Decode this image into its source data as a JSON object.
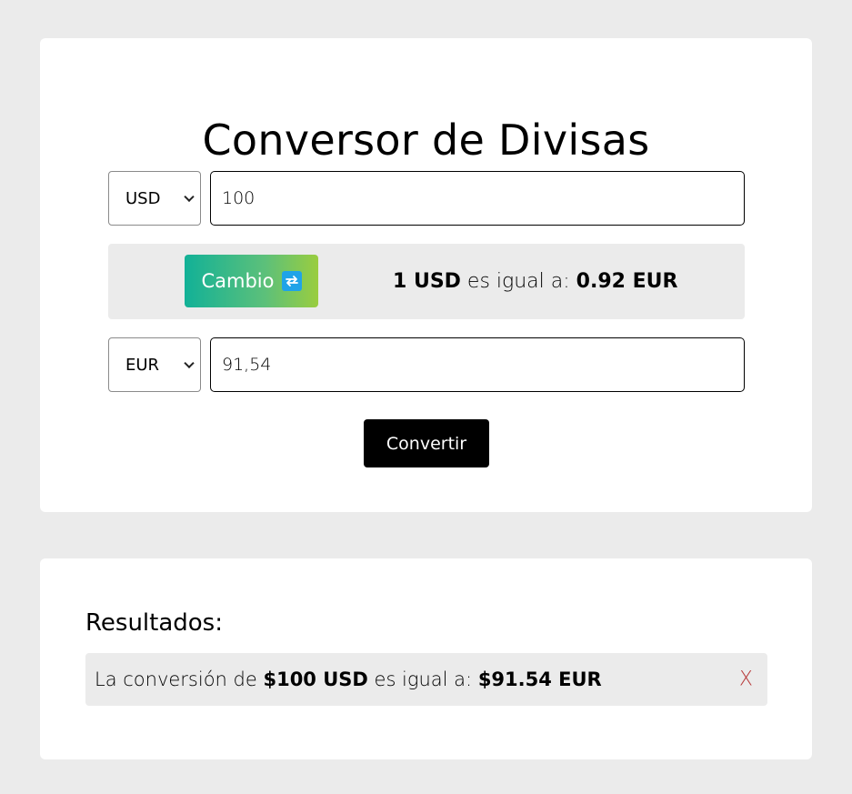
{
  "converter": {
    "title": "Conversor de Divisas",
    "from": {
      "currency": "USD",
      "amount": "100"
    },
    "to": {
      "currency": "EUR",
      "amount": "91,54"
    },
    "swap_button_label": "Cambio",
    "swap_icon": "swap-arrows-icon",
    "rate": {
      "base": "1 USD",
      "middle": " es igual a: ",
      "value": "0.92 EUR"
    },
    "convert_button_label": "Convertir"
  },
  "results": {
    "title": "Resultados:",
    "items": [
      {
        "prefix": "La conversión de ",
        "from": "$100 USD",
        "middle": " es igual a: ",
        "to": "$91.54 EUR",
        "delete_label": "X"
      }
    ]
  },
  "colors": {
    "background": "#ebebeb",
    "card": "#ffffff",
    "gradient_start": "#12b197",
    "gradient_end": "#9acd3f",
    "swap_icon_bg": "#1fa3e8",
    "convert_button": "#000000",
    "delete": "#b83c3c"
  }
}
